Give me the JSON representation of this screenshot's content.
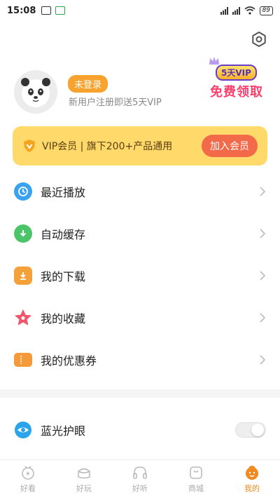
{
  "status_bar": {
    "time": "15:08",
    "battery": "89"
  },
  "profile": {
    "login_badge": "未登录",
    "subtitle": "新用户注册即送5天VIP",
    "promo_tag": "5天VIP",
    "promo_text": "免费领取"
  },
  "vip": {
    "text": "VIP会员 |  旗下200+产品通用",
    "button": "加入会员"
  },
  "menu": [
    {
      "label": "最近播放",
      "icon": "clock-icon",
      "color": "#3aa3f0"
    },
    {
      "label": "自动缓存",
      "icon": "download-cloud-icon",
      "color": "#4cc46a"
    },
    {
      "label": "我的下载",
      "icon": "download-icon",
      "color": "#f5a13a"
    },
    {
      "label": "我的收藏",
      "icon": "star-icon",
      "color": "#f0566a"
    },
    {
      "label": "我的优惠券",
      "icon": "coupon-icon",
      "color": "#f59a3a"
    }
  ],
  "settings_rows": {
    "eye_care": "蓝光护眼"
  },
  "bottom_nav": [
    {
      "label": "好看"
    },
    {
      "label": "好玩"
    },
    {
      "label": "好听"
    },
    {
      "label": "商城"
    },
    {
      "label": "我的",
      "active": true
    }
  ],
  "colors": {
    "accent": "#f08a20",
    "vip_bg": "#ffd96a",
    "vip_button": "#f26a4a"
  }
}
